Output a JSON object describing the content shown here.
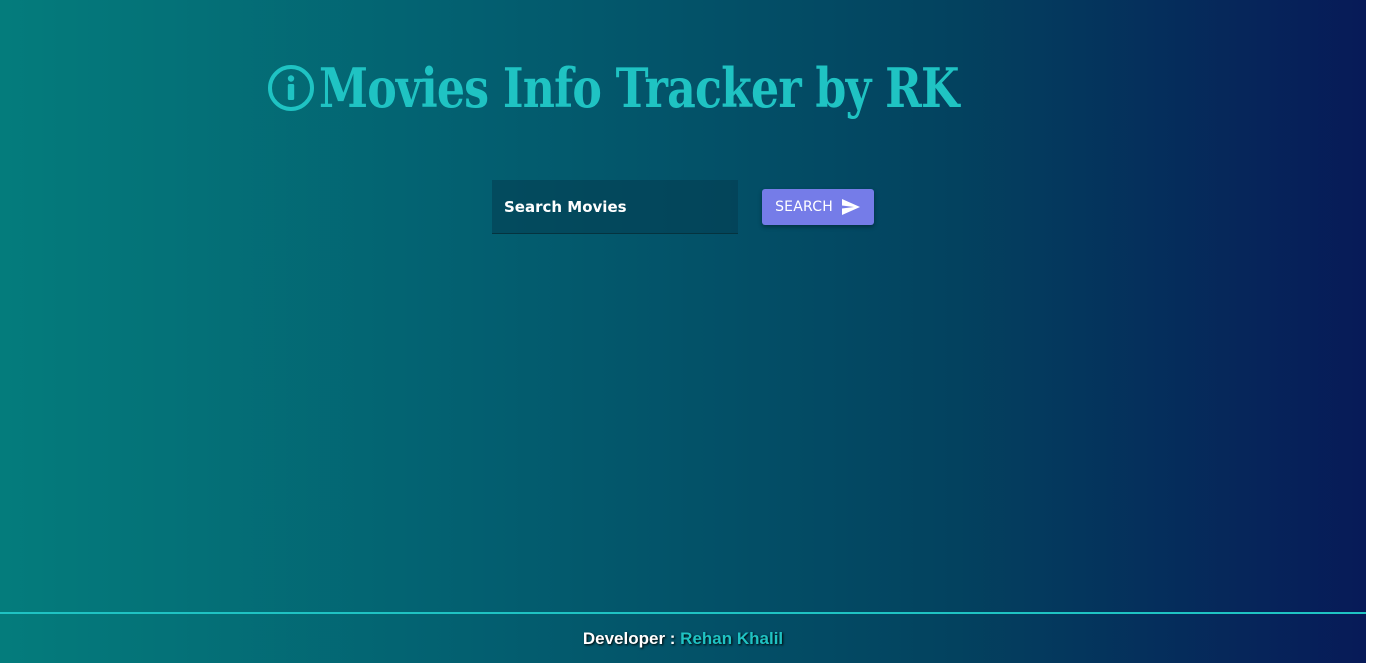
{
  "header": {
    "title": "Movies Info Tracker by RK",
    "icon": "info-circle-icon"
  },
  "search": {
    "placeholder": "Search Movies",
    "value": "",
    "button_label": "SEARCH",
    "button_icon": "send-icon"
  },
  "footer": {
    "label": "Developer : ",
    "developer_name": "Rehan Khalil"
  },
  "colors": {
    "accent": "#1fc3c3",
    "button": "#757ce8",
    "gradient_start": "#047c7c",
    "gradient_end": "#071a58"
  }
}
